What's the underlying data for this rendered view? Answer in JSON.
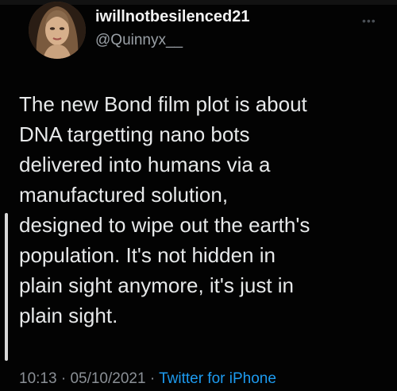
{
  "tweet": {
    "display_name": "iwillnotbesilenced21",
    "handle": "@Quinnyx__",
    "more_icon": "more-dots-icon",
    "text_lines": [
      "The new Bond film plot is about",
      "DNA targetting nano bots",
      "delivered into humans via a",
      "manufactured solution,",
      "designed to wipe out the earth's",
      "population. It's not hidden in",
      "plain sight anymore, it's just in",
      "plain sight."
    ],
    "time": "10:13",
    "separator": "·",
    "date": "05/10/2021",
    "source": "Twitter for iPhone"
  },
  "colors": {
    "background": "#030303",
    "text": "#e7e9ea",
    "muted": "#8b9096",
    "link": "#1d9bf0"
  }
}
